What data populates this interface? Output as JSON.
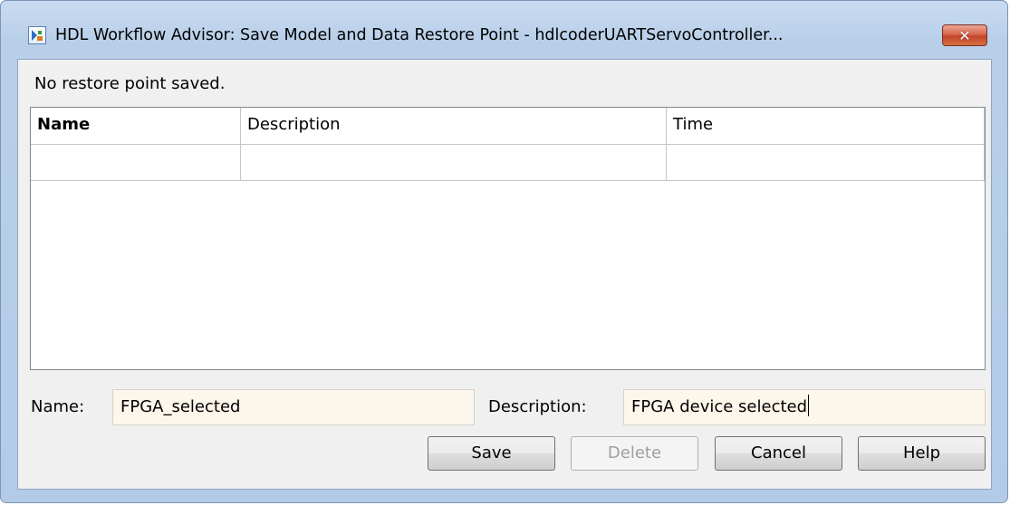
{
  "window": {
    "title": "HDL Workflow Advisor: Save Model and Data Restore Point - hdlcoderUARTServoController...",
    "app_icon": "workflow-advisor-icon",
    "close_glyph": "✕"
  },
  "status_text": "No restore point saved.",
  "table": {
    "columns": [
      "Name",
      "Description",
      "Time"
    ],
    "rows": [
      [
        "",
        "",
        ""
      ]
    ]
  },
  "form": {
    "name_label": "Name:",
    "name_value": "FPGA_selected",
    "description_label": "Description:",
    "description_value": "FPGA device selected"
  },
  "buttons": {
    "save": "Save",
    "delete": "Delete",
    "cancel": "Cancel",
    "help": "Help"
  },
  "colors": {
    "input_background": "#fdf6ea",
    "close_button": "#c2442b",
    "window_frame": "#b9cfe9"
  }
}
